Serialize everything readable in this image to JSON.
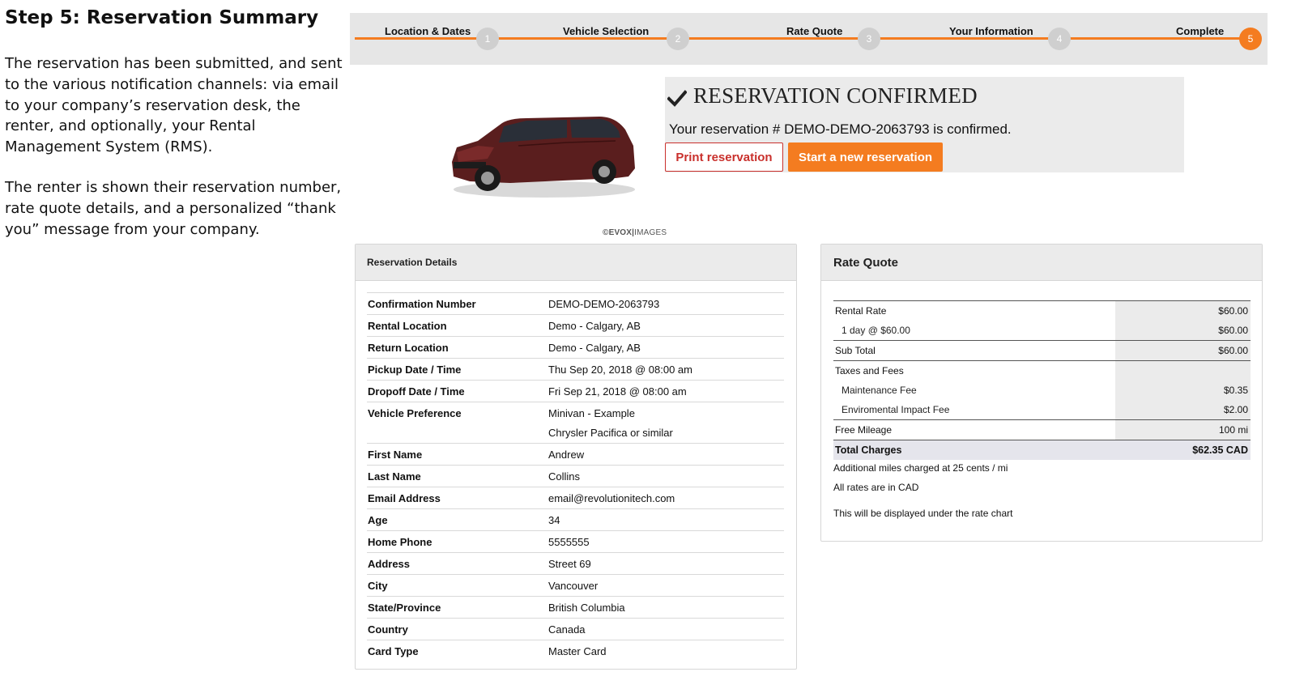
{
  "intro": {
    "title": "Step 5: Reservation Summary",
    "p1": "The reservation has been submitted, and sent to the various notification channels: via email to your company’s reservation desk, the renter, and optionally, your Rental Management System (RMS).",
    "p2": "The renter is shown their reservation number, rate quote details, and a personalized “thank you” message from your company."
  },
  "steps": [
    {
      "label": "Location & Dates",
      "num": "1"
    },
    {
      "label": "Vehicle Selection",
      "num": "2"
    },
    {
      "label": "Rate Quote",
      "num": "3"
    },
    {
      "label": "Your Information",
      "num": "4"
    },
    {
      "label": "Complete",
      "num": "5"
    }
  ],
  "confirmation": {
    "title": "RESERVATION CONFIRMED",
    "message": "Your reservation # DEMO-DEMO-2063793 is confirmed.",
    "print_label": "Print reservation",
    "new_label": "Start a new reservation"
  },
  "image_credit": {
    "brand": "©EVOX",
    "suffix": "IMAGES"
  },
  "reservation_details": {
    "title": "Reservation Details",
    "rows": [
      {
        "label": "Confirmation Number",
        "value": "DEMO-DEMO-2063793"
      },
      {
        "label": "Rental Location",
        "value": "Demo - Calgary, AB"
      },
      {
        "label": "Return Location",
        "value": "Demo - Calgary, AB"
      },
      {
        "label": "Pickup Date / Time",
        "value": "Thu Sep 20, 2018 @ 08:00 am"
      },
      {
        "label": "Dropoff Date / Time",
        "value": "Fri Sep 21, 2018 @ 08:00 am"
      },
      {
        "label": "Vehicle Preference",
        "value": "Minivan - Example",
        "value2": "Chrysler Pacifica or similar"
      },
      {
        "label": "First Name",
        "value": "Andrew"
      },
      {
        "label": "Last Name",
        "value": "Collins"
      },
      {
        "label": "Email Address",
        "value": "email@revolutionitech.com"
      },
      {
        "label": "Age",
        "value": "34"
      },
      {
        "label": "Home Phone",
        "value": "5555555"
      },
      {
        "label": "Address",
        "value": "Street 69"
      },
      {
        "label": "City",
        "value": "Vancouver"
      },
      {
        "label": "State/Province",
        "value": "British Columbia"
      },
      {
        "label": "Country",
        "value": "Canada"
      },
      {
        "label": "Card Type",
        "value": "Master Card"
      }
    ]
  },
  "rate_quote": {
    "title": "Rate Quote",
    "rows": [
      {
        "label": "Rental Rate",
        "amount": "$60.00",
        "kind": "top"
      },
      {
        "label": "1 day @ $60.00",
        "amount": "$60.00",
        "kind": "sub"
      },
      {
        "label": "Sub Total",
        "amount": "$60.00",
        "kind": "top"
      },
      {
        "label": "Taxes and Fees",
        "amount": "",
        "kind": "top"
      },
      {
        "label": "Maintenance Fee",
        "amount": "$0.35",
        "kind": "sub"
      },
      {
        "label": "Enviromental Impact Fee",
        "amount": "$2.00",
        "kind": "sub"
      },
      {
        "label": "Free Mileage",
        "amount": "100 mi",
        "kind": "top"
      },
      {
        "label": "Total Charges",
        "amount": "$62.35 CAD",
        "kind": "total"
      }
    ],
    "note1": "Additional miles charged at 25 cents / mi",
    "note2": "All rates are in CAD",
    "note3": "This will be displayed under the rate chart"
  }
}
